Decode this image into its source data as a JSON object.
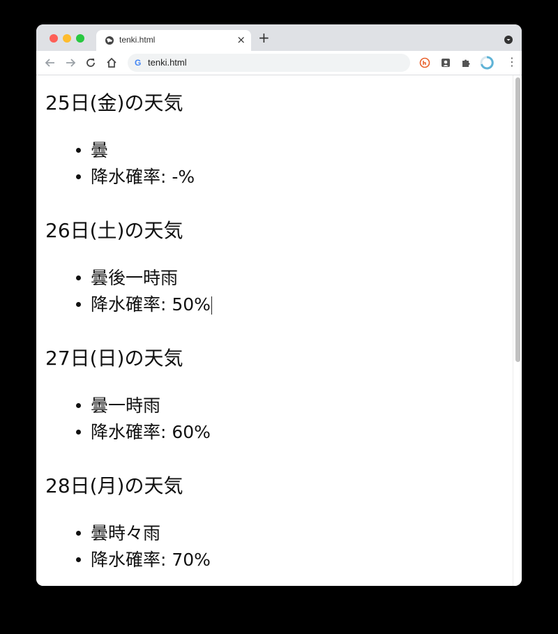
{
  "browser": {
    "tab_title": "tenki.html",
    "close_glyph": "×",
    "newtab_glyph": "+",
    "url": "tenki.html",
    "search_engine_glyph": "G",
    "menu_glyph": "⋮"
  },
  "days": [
    {
      "heading": "25日(金)の天気",
      "weather": "曇",
      "precip": "降水確率: -%"
    },
    {
      "heading": "26日(土)の天気",
      "weather": "曇後一時雨",
      "precip": "降水確率: 50%"
    },
    {
      "heading": "27日(日)の天気",
      "weather": "曇一時雨",
      "precip": "降水確率: 60%"
    },
    {
      "heading": "28日(月)の天気",
      "weather": "曇時々雨",
      "precip": "降水確率: 70%"
    }
  ],
  "colors": {
    "accent_brand": "#4285f4",
    "close_red": "#fe5f57",
    "minimize_yellow": "#febc2e",
    "zoom_green": "#28c840"
  },
  "icons": [
    "back-icon",
    "forward-icon",
    "reload-icon",
    "home-icon",
    "globe-icon",
    "extension-icons",
    "puzzle-icon"
  ]
}
